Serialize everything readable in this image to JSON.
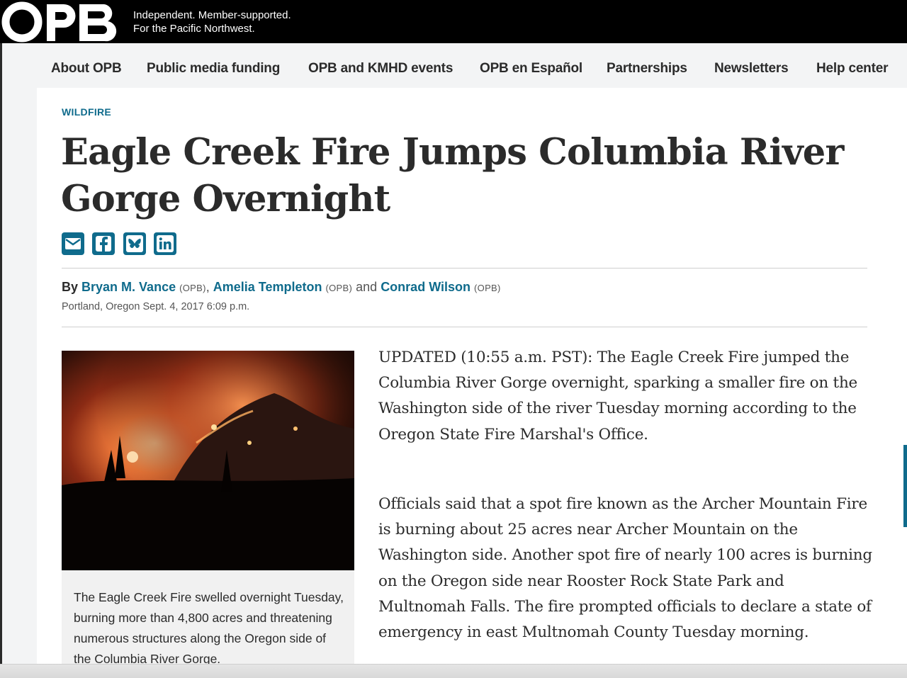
{
  "header": {
    "logo_text": "OPB",
    "tagline_line1": "Independent. Member-supported.",
    "tagline_line2": "For the Pacific Northwest."
  },
  "nav": {
    "items": [
      {
        "label": "About OPB"
      },
      {
        "label": "Public media funding"
      },
      {
        "label": "OPB and KMHD events"
      },
      {
        "label": "OPB en Español"
      },
      {
        "label": "Partnerships"
      },
      {
        "label": "Newsletters"
      },
      {
        "label": "Help center"
      }
    ]
  },
  "article": {
    "kicker": "WILDFIRE",
    "title": "Eagle Creek Fire Jumps Columbia River Gorge Overnight",
    "share_icons": [
      "email-icon",
      "facebook-icon",
      "bluesky-icon",
      "linkedin-icon"
    ],
    "byline": {
      "by": "By",
      "authors": [
        {
          "name": "Bryan M. Vance",
          "org": "(OPB)"
        },
        {
          "name": "Amelia Templeton",
          "org": "(OPB)"
        },
        {
          "name": "Conrad Wilson",
          "org": "(OPB)"
        }
      ],
      "comma": ",",
      "and": "and"
    },
    "dateline": "Portland, Oregon Sept. 4, 2017 6:09 p.m.",
    "photo_caption": "The Eagle Creek Fire swelled overnight Tuesday, burning more than 4,800 acres and threatening numerous structures along the Oregon side of the Columbia River Gorge.",
    "paragraphs": [
      "UPDATED (10:55 a.m. PST): The Eagle Creek Fire jumped the Columbia River Gorge overnight, sparking a smaller fire on the Washington side of the river Tuesday morning according to the Oregon State Fire Marshal's Office.",
      "Officials said that a spot fire known as the Archer Mountain Fire is burning about 25 acres near Archer Mountain on the Washington side. Another spot fire of nearly 100 acres is burning on the Oregon side near Rooster Rock State Park and Multnomah Falls. The fire prompted officials to declare a state of emergency in east Multnomah County Tuesday morning."
    ]
  },
  "colors": {
    "accent": "#0f6b8c",
    "text": "#2b2b2b",
    "header_bg": "#000000"
  }
}
